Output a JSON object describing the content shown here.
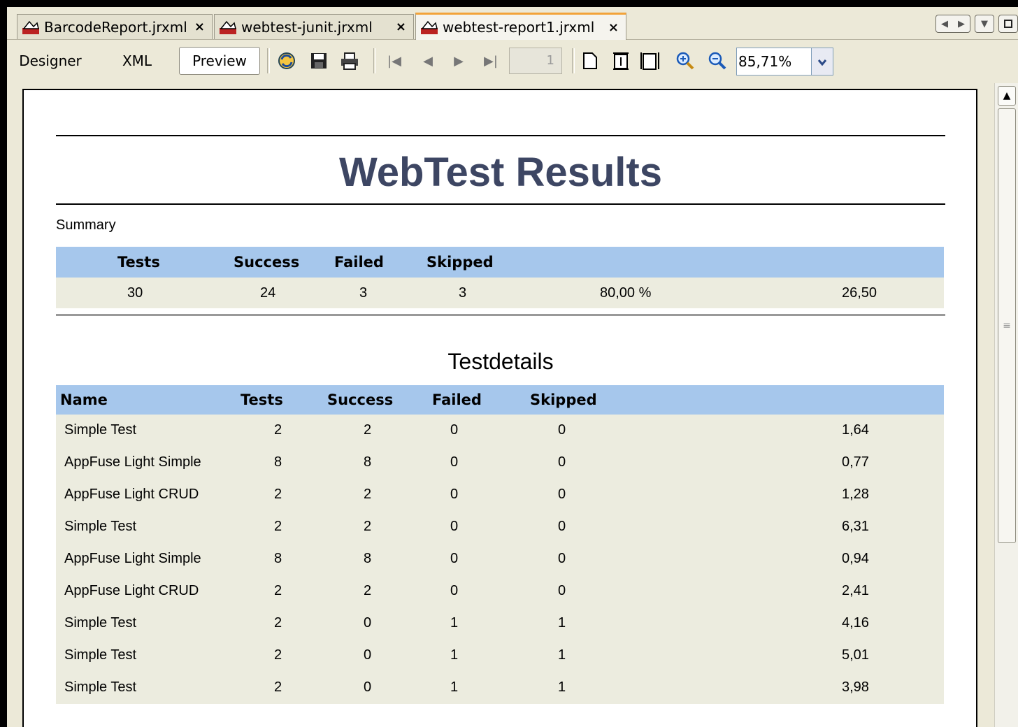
{
  "tabs": [
    {
      "label": "BarcodeReport.jrxml",
      "close": "×",
      "active": false
    },
    {
      "label": "webtest-junit.jrxml",
      "close": "×",
      "active": false
    },
    {
      "label": "webtest-report1.jrxml",
      "close": "×",
      "active": true
    }
  ],
  "modes": {
    "designer": "Designer",
    "xml": "XML",
    "preview": "Preview"
  },
  "toolbar": {
    "page_number": "1",
    "zoom": "85,71%"
  },
  "icons": {
    "tab_file": "report-file-icon",
    "reload": "reload-icon",
    "save": "save-icon",
    "print": "print-icon",
    "first": "first-page-icon",
    "prev": "previous-page-icon",
    "next": "next-page-icon",
    "last": "last-page-icon",
    "actual_size": "actual-size-icon",
    "fit_page": "fit-page-icon",
    "fit_width": "fit-width-icon",
    "zoom_in": "zoom-in-icon",
    "zoom_out": "zoom-out-icon"
  },
  "report": {
    "title": "WebTest Results",
    "summary_label": "Summary",
    "summary_headers": [
      "Tests",
      "Success",
      "Failed",
      "Skipped"
    ],
    "summary_values": [
      "30",
      "24",
      "3",
      "3",
      "80,00 %",
      "26,50"
    ],
    "details_title": "Testdetails",
    "details_headers": [
      "Name",
      "Tests",
      "Success",
      "Failed",
      "Skipped"
    ],
    "details_rows": [
      [
        "Simple Test",
        "2",
        "2",
        "0",
        "0",
        "1,64"
      ],
      [
        "AppFuse Light Simple",
        "8",
        "8",
        "0",
        "0",
        "0,77"
      ],
      [
        "AppFuse Light CRUD",
        "2",
        "2",
        "0",
        "0",
        "1,28"
      ],
      [
        "Simple Test",
        "2",
        "2",
        "0",
        "0",
        "6,31"
      ],
      [
        "AppFuse Light Simple",
        "8",
        "8",
        "0",
        "0",
        "0,94"
      ],
      [
        "AppFuse Light CRUD",
        "2",
        "2",
        "0",
        "0",
        "2,41"
      ],
      [
        "Simple Test",
        "2",
        "0",
        "1",
        "1",
        "4,16"
      ],
      [
        "Simple Test",
        "2",
        "0",
        "1",
        "1",
        "5,01"
      ],
      [
        "Simple Test",
        "2",
        "0",
        "1",
        "1",
        "3,98"
      ]
    ]
  },
  "colors": {
    "header_bg": "#a6c7ec",
    "row_bg": "#ececdf",
    "title": "#3d4663",
    "active_tab_accent": "#f2a33a"
  }
}
